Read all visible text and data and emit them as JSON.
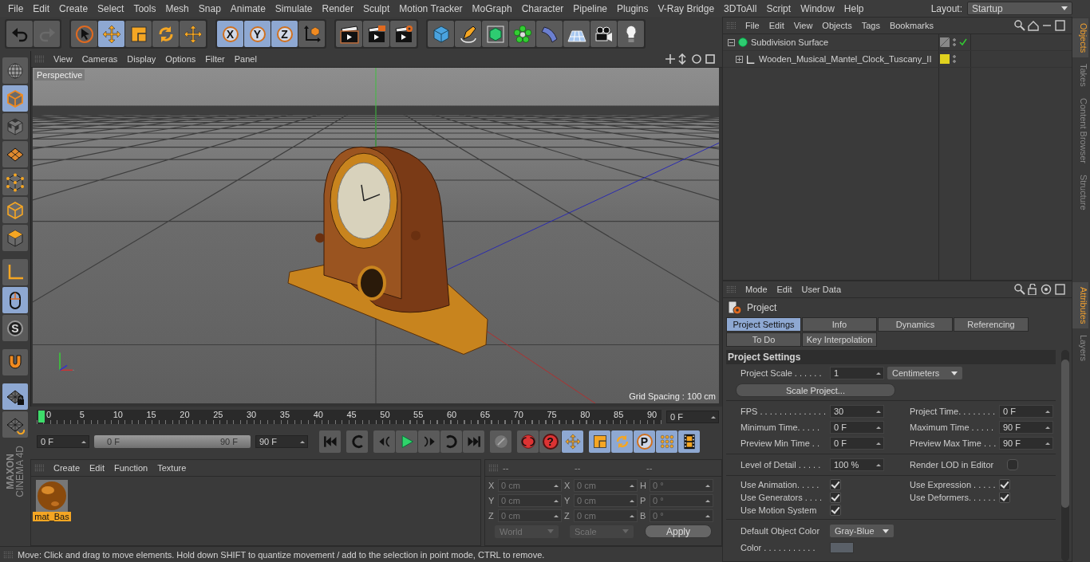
{
  "menu_bar": {
    "items": [
      "File",
      "Edit",
      "Create",
      "Select",
      "Tools",
      "Mesh",
      "Snap",
      "Animate",
      "Simulate",
      "Render",
      "Sculpt",
      "Motion Tracker",
      "MoGraph",
      "Character",
      "Pipeline",
      "Plugins",
      "V-Ray Bridge",
      "3DToAll",
      "Script",
      "Window",
      "Help"
    ],
    "layout_label": "Layout:",
    "layout_value": "Startup"
  },
  "toolbar": {
    "groups": [
      {
        "tools": [
          {
            "kind": "undo",
            "selected": false
          },
          {
            "kind": "redo",
            "selected": false
          }
        ]
      },
      {
        "tools": [
          {
            "kind": "select",
            "selected": false
          },
          {
            "kind": "move",
            "selected": true
          },
          {
            "kind": "scale",
            "selected": false
          },
          {
            "kind": "rotate",
            "selected": false
          },
          {
            "kind": "move",
            "selected": false
          }
        ]
      },
      {
        "tools": [
          {
            "kind": "axis",
            "label": "X",
            "selected": true
          },
          {
            "kind": "axis",
            "label": "Y",
            "selected": true
          },
          {
            "kind": "axis",
            "label": "Z",
            "selected": true
          },
          {
            "kind": "coord",
            "selected": false
          }
        ]
      },
      {
        "tools": [
          {
            "kind": "render-view",
            "selected": false
          },
          {
            "kind": "render-picture",
            "selected": false
          },
          {
            "kind": "render-settings",
            "selected": false
          }
        ]
      },
      {
        "tools": [
          {
            "kind": "cube",
            "selected": false
          },
          {
            "kind": "pen",
            "selected": false
          },
          {
            "kind": "subdiv",
            "selected": false
          },
          {
            "kind": "cloner",
            "selected": false
          },
          {
            "kind": "deformer",
            "selected": false
          },
          {
            "kind": "floor",
            "selected": false
          },
          {
            "kind": "camera",
            "selected": false
          },
          {
            "kind": "light",
            "selected": false
          }
        ]
      }
    ]
  },
  "left_strip": {
    "tools": [
      {
        "kind": "globe",
        "selected": false
      },
      {
        "kind": "model",
        "selected": true
      },
      {
        "kind": "texture",
        "selected": false
      },
      {
        "kind": "workplane",
        "selected": false
      },
      {
        "kind": "points",
        "selected": false
      },
      {
        "kind": "edges",
        "selected": false
      },
      {
        "kind": "polygons",
        "selected": false
      },
      {
        "kind": "axis-mode",
        "selected": false
      },
      {
        "kind": "tweak",
        "selected": true
      },
      {
        "kind": "snap",
        "label": "S",
        "selected": false
      },
      {
        "kind": "magnet",
        "selected": false
      },
      {
        "kind": "grid-lock",
        "selected": true
      },
      {
        "kind": "grid-rotate",
        "selected": false
      }
    ],
    "logo": [
      "MAXON",
      "CINEMA 4D"
    ]
  },
  "viewport": {
    "menu": [
      "View",
      "Cameras",
      "Display",
      "Options",
      "Filter",
      "Panel"
    ],
    "camera_label": "Perspective",
    "grid_spacing": "Grid Spacing : 100 cm"
  },
  "timeline": {
    "ticks": [
      "0",
      "5",
      "10",
      "15",
      "20",
      "25",
      "30",
      "35",
      "40",
      "45",
      "50",
      "55",
      "60",
      "65",
      "70",
      "75",
      "80",
      "85",
      "90"
    ],
    "playhead": {
      "level": 0
    },
    "current_frame": "0 F",
    "start_field": "0 F",
    "range": {
      "start": "0 F",
      "end": "90 F",
      "level": 1
    },
    "end_field": "90 F",
    "transport": [
      {
        "kind": "first",
        "selected": false
      },
      {
        "kind": "prev-key",
        "selected": false
      },
      {
        "kind": "prev-frame",
        "selected": false
      },
      {
        "kind": "play",
        "selected": false
      },
      {
        "kind": "next-frame",
        "selected": false
      },
      {
        "kind": "next-key",
        "selected": false
      },
      {
        "kind": "last",
        "selected": false
      },
      {
        "kind": "record",
        "selected": false
      },
      {
        "kind": "autokey",
        "selected": false
      },
      {
        "kind": "keyhelp",
        "label": "?",
        "selected": false
      },
      {
        "kind": "move",
        "selected": true
      },
      {
        "kind": "scale",
        "selected": true
      },
      {
        "kind": "rotate",
        "selected": true
      },
      {
        "kind": "param",
        "label": "P",
        "selected": true
      },
      {
        "kind": "pla",
        "selected": true
      },
      {
        "kind": "film",
        "selected": true
      }
    ]
  },
  "materials": {
    "menu": [
      "Create",
      "Edit",
      "Function",
      "Texture"
    ],
    "items": [
      {
        "name": "mat_Bas",
        "selected": true
      }
    ]
  },
  "coordinates": {
    "headers": [
      "--",
      "--",
      "--"
    ],
    "rows": [
      {
        "axis": "X",
        "value": "0 cm",
        "axis_2": "X",
        "value_2": "0 cm",
        "axis_3": "H",
        "value_3": "0 °"
      },
      {
        "axis": "Y",
        "value": "0 cm",
        "axis_2": "Y",
        "value_2": "0 cm",
        "axis_3": "P",
        "value_3": "0 °"
      },
      {
        "axis": "Z",
        "value": "0 cm",
        "axis_2": "Z",
        "value_2": "0 cm",
        "axis_3": "B",
        "value_3": "0 °"
      }
    ],
    "mode": "World",
    "mode_2": "Scale",
    "apply": "Apply",
    "disabled": true
  },
  "status_bar": "Move: Click and drag to move elements. Hold down SHIFT to quantize movement / add to the selection in point mode, CTRL to remove.",
  "objects": {
    "menu": [
      "File",
      "Edit",
      "View",
      "Objects",
      "Tags",
      "Bookmarks"
    ],
    "tree": [
      {
        "name": "Subdivision Surface",
        "kind": "generator",
        "expanded": true,
        "enabled": true,
        "children": [
          {
            "name": "Wooden_Musical_Mantel_Clock_Tuscany_II",
            "kind": "null",
            "expanded": false,
            "color": "#e0d21e"
          }
        ]
      }
    ],
    "side_tabs": [
      {
        "label": "Objects",
        "selected": true
      },
      {
        "label": "Takes",
        "selected": false
      },
      {
        "label": "Content Browser",
        "selected": false
      },
      {
        "label": "Structure",
        "selected": false
      }
    ]
  },
  "attributes": {
    "menu": [
      "Mode",
      "Edit",
      "User Data"
    ],
    "title": "Project",
    "tabs": [
      {
        "label": "Project Settings",
        "selected": true
      },
      {
        "label": "Info",
        "selected": false
      },
      {
        "label": "Dynamics",
        "selected": false
      },
      {
        "label": "Referencing",
        "selected": false
      },
      {
        "label": "To Do",
        "selected": false
      },
      {
        "label": "Key Interpolation",
        "selected": false
      }
    ],
    "section": "Project Settings",
    "scale": {
      "label": "Project Scale . . . . . .",
      "value": "1",
      "unit": "Centimeters"
    },
    "scale_button": "Scale Project...",
    "time_fields": [
      {
        "label": "FPS . . . . . . . . . . . . . .",
        "value": "30"
      },
      {
        "label": "Project Time. . . . . . . .",
        "value": "0 F"
      },
      {
        "label": "Minimum Time. . . . .",
        "value": "0 F"
      },
      {
        "label": "Maximum Time . . . . .",
        "value": "90 F"
      },
      {
        "label": "Preview Min Time . .",
        "value": "0 F"
      },
      {
        "label": "Preview Max Time . . .",
        "value": "90 F"
      }
    ],
    "lod": {
      "label": "Level of Detail . . . . .",
      "value": "100 %"
    },
    "render_lod": {
      "label": "Render LOD in Editor",
      "checked": false
    },
    "checks": [
      {
        "label": "Use Animation. . . . .",
        "checked": true
      },
      {
        "label": "Use Expression . . . . .",
        "checked": true
      },
      {
        "label": "Use Generators . . . .",
        "checked": true
      },
      {
        "label": "Use Deformers. . . . . .",
        "checked": true
      },
      {
        "label": "Use Motion System",
        "checked": true
      }
    ],
    "default_color": {
      "label": "Default Object Color",
      "value": "Gray-Blue"
    },
    "color_label": "Color . . . . . . . . . . .",
    "side_tabs": [
      {
        "label": "Attributes",
        "selected": true
      },
      {
        "label": "Layers",
        "selected": false
      }
    ]
  }
}
